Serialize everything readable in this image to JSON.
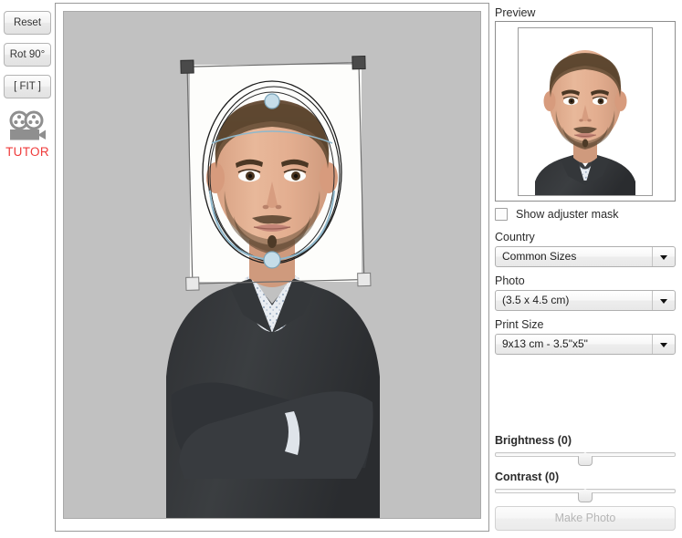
{
  "toolbar": {
    "reset_label": "Reset",
    "rotate_label": "Rot 90°",
    "fit_label": "[ FIT ]",
    "tutor_label": "TUTOR"
  },
  "preview": {
    "title": "Preview"
  },
  "mask": {
    "label": "Show adjuster mask",
    "checked": false
  },
  "fields": {
    "country_label": "Country",
    "country_value": "Common Sizes",
    "photo_label": "Photo",
    "photo_value": "(3.5 x 4.5 cm)",
    "print_label": "Print Size",
    "print_value": "9x13 cm - 3.5\"x5\""
  },
  "sliders": {
    "brightness_label": "Brightness (0)",
    "brightness_value": 0,
    "contrast_label": "Contrast (0)",
    "contrast_value": 0
  },
  "actions": {
    "make_photo_label": "Make Photo",
    "make_photo_enabled": false
  },
  "colors": {
    "tutor_red": "#ef3b3b",
    "canvas_gray": "#c1c1c1",
    "handle_dark": "#4a4a4a",
    "handle_light": "#e8e8e8",
    "guide_blue": "#b9d6e4"
  }
}
